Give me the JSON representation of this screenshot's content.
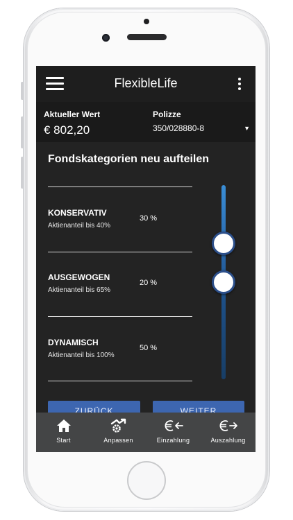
{
  "app": {
    "title": "FlexibleLife"
  },
  "info": {
    "value_label": "Aktueller Wert",
    "value": "€ 802,20",
    "policy_label": "Polizze",
    "policy_value": "350/028880-8"
  },
  "section": {
    "title": "Fondskategorien neu aufteilen"
  },
  "categories": [
    {
      "name": "KONSERVATIV",
      "desc": "Aktienanteil bis 40%",
      "percent": "30 %"
    },
    {
      "name": "AUSGEWOGEN",
      "desc": "Aktienanteil bis 65%",
      "percent": "20 %"
    },
    {
      "name": "DYNAMISCH",
      "desc": "Aktienanteil bis 100%",
      "percent": "50 %"
    }
  ],
  "slider": {
    "values_percent": [
      30,
      50
    ]
  },
  "buttons": {
    "back": "ZURÜCK",
    "next": "WEITER"
  },
  "nav": [
    {
      "label": "Start",
      "icon": "home-icon"
    },
    {
      "label": "Anpassen",
      "icon": "adjust-gear-icon"
    },
    {
      "label": "Einzahlung",
      "icon": "euro-deposit-icon"
    },
    {
      "label": "Auszahlung",
      "icon": "euro-withdraw-icon"
    }
  ],
  "colors": {
    "accent": "#3d66b0",
    "background": "#1f1f1f",
    "nav": "#444546"
  }
}
